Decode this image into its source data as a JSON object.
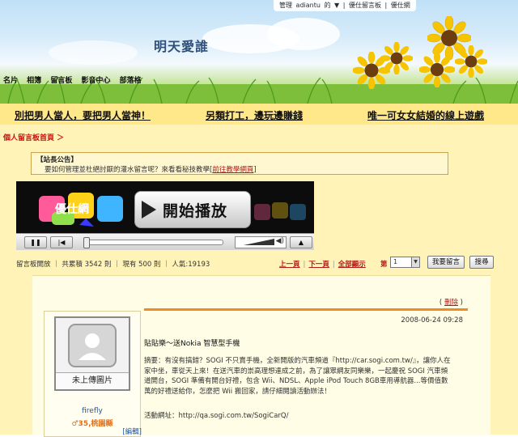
{
  "banner": {
    "title": "明天愛誰",
    "topbar": [
      "管理",
      "adiantu",
      "的",
      "▼",
      "|",
      "優仕留言板",
      "|",
      "優仕網"
    ],
    "nav": [
      "名片",
      "相簿",
      "留言板",
      "影音中心",
      "部落格"
    ]
  },
  "ads": [
    "別把男人當人，要把男人當神！",
    "另類打工，邊玩邊賺錢",
    "唯一可女女結婚的線上遊戲"
  ],
  "breadcrumb": "個人留言板首頁 ＞",
  "notice": {
    "heading": "【站長公告】",
    "text": "要如何管理並杜絕討厭的灌水留言呢？來看看秘技教學",
    "link": "前往教學網頁"
  },
  "player": {
    "play_label": "開始播放",
    "logo_text": "優仕網"
  },
  "pager": {
    "stats": "留言板開放 ｜ 共累積 3542 則 ｜ 現有 500 則 ｜ 人氣:19193",
    "prev": "上一頁",
    "next": "下一頁",
    "all": "全部顯示",
    "page_label": "第",
    "page_value": "1",
    "leave_message": "我要留言",
    "search": "搜尋"
  },
  "post": {
    "delete": "刪除",
    "avatar_caption": "未上傳圖片",
    "username": "firefly",
    "userinfo": "♂35,桃園縣",
    "edit": "[編輯]",
    "date": "2008-06-24 09:28",
    "title": "貼貼樂～送Nokia 智慧型手機",
    "body": "摘要：有沒有搞錯？SOGI 不只賣手機，全新開版的汽車頻道『http://car.sogi.com.tw/』，讓你人在家中坐，車從天上來！在送汽車的崇高理想達成之前，為了讓眾網友同樂樂，一起慶祝 SOGI 汽車頻道開台，SOGI 準備有開台好禮，包含 Wii、NDSL、Apple iPod Touch 8GB車用導航器...等價值數萬的好禮送給你，怎麼把 Wii 搬回家，請仔細閱讀活動辦法！",
    "url": "活動網址：http://qa.sogi.com.tw/SogiCarQ/"
  },
  "colors": {
    "accent": "#b31a1a",
    "content_bg": "#fff3b8",
    "adrow_bg": "#ffe88a",
    "post_line": "#f08a22",
    "link_blue": "#1a57a8"
  }
}
